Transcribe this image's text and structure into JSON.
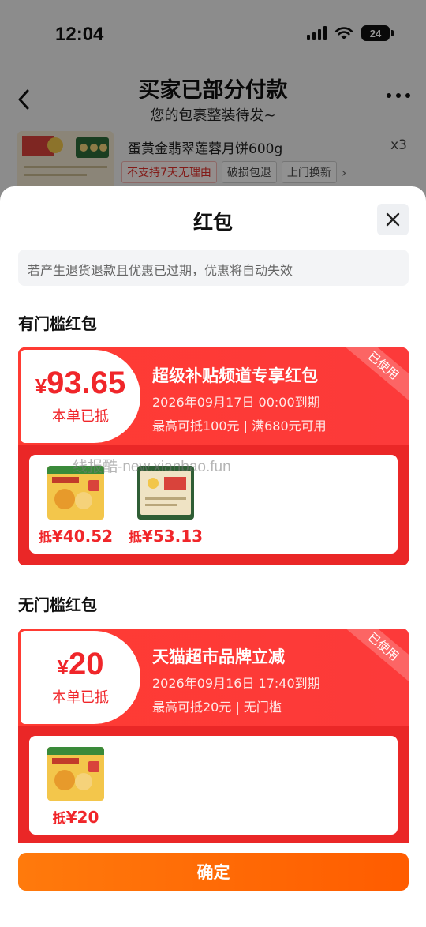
{
  "status_bar": {
    "time": "12:04",
    "battery": "24"
  },
  "background_page": {
    "title": "买家已部分付款",
    "subtitle": "您的包裹整装待发~",
    "order": {
      "name": "蛋黄金翡翠莲蓉月饼600g",
      "qty": "x3",
      "tags": [
        "不支持7天无理由",
        "破损包退",
        "上门换新"
      ]
    }
  },
  "sheet": {
    "title": "红包",
    "notice": "若产生退货退款且优惠已过期，优惠将自动失效",
    "confirm_label": "确定"
  },
  "watermark": "线报酷-new.xianbao.fun",
  "sections": [
    {
      "title": "有门槛红包",
      "coupon": {
        "currency": "¥",
        "amount": "93.65",
        "used_label": "本单已抵",
        "name": "超级补贴频道专享红包",
        "expire": "2026年09月17日  00:00到期",
        "rule": "最高可抵100元 | 满680元可用",
        "stamp": "已使用",
        "items": [
          {
            "prefix": "抵",
            "amount": "¥40.52"
          },
          {
            "prefix": "抵",
            "amount": "¥53.13"
          }
        ]
      }
    },
    {
      "title": "无门槛红包",
      "coupon": {
        "currency": "¥",
        "amount": "20",
        "used_label": "本单已抵",
        "name": "天猫超市品牌立减",
        "expire": "2026年09月16日  17:40到期",
        "rule": "最高可抵20元 | 无门槛",
        "stamp": "已使用",
        "items": [
          {
            "prefix": "抵",
            "amount": "¥20"
          }
        ]
      }
    }
  ],
  "colors": {
    "accent_red": "#f0262a",
    "confirm_orange": "#ff6a00"
  }
}
